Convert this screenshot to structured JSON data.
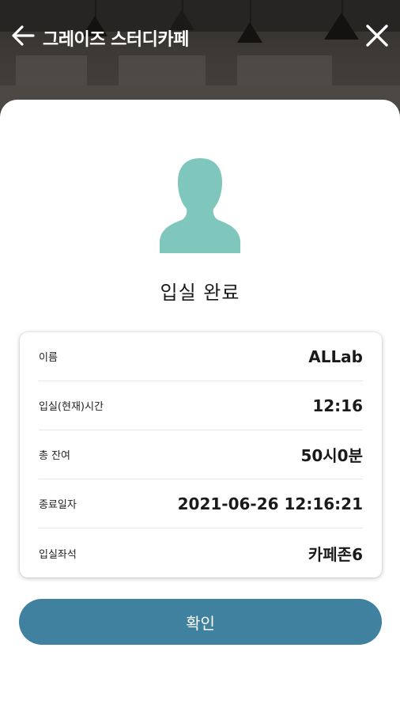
{
  "header": {
    "title": "그레이즈 스터디카페",
    "back_icon": "arrow-left-icon",
    "close_icon": "close-icon"
  },
  "status": {
    "title": "입실 완료",
    "avatar_icon": "person-silhouette-icon",
    "avatar_color": "#7fc6bc"
  },
  "info": {
    "rows": [
      {
        "label": "이름",
        "value": "ALLab"
      },
      {
        "label": "입실(현재)시간",
        "value": "12:16"
      },
      {
        "label": "총 잔여",
        "value": "50시0분"
      },
      {
        "label": "종료일자",
        "value": "2021-06-26 12:16:21"
      },
      {
        "label": "입실좌석",
        "value": "카페존6"
      }
    ]
  },
  "actions": {
    "confirm_label": "확인",
    "confirm_color": "#3f819e"
  }
}
